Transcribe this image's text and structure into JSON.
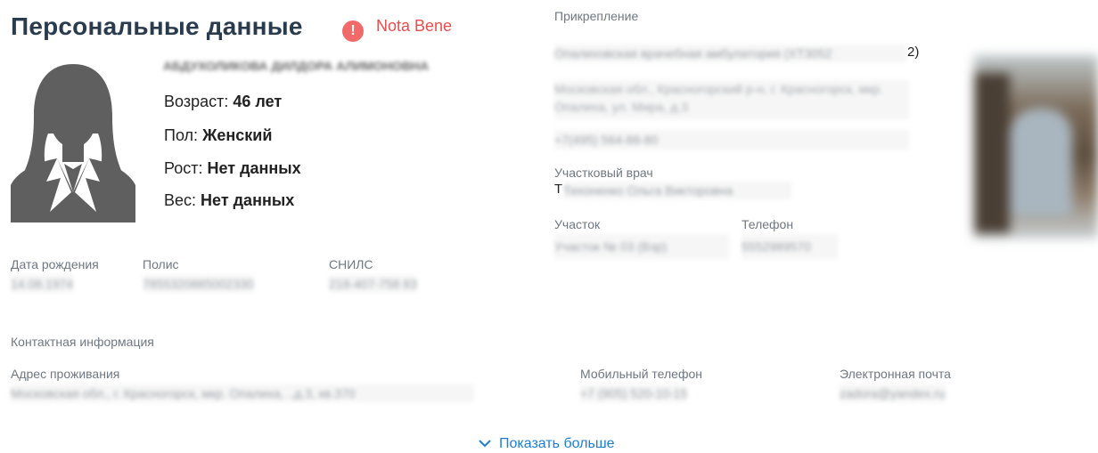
{
  "header": {
    "title": "Персональные данные",
    "nota_bene_icon": "!",
    "nota_bene": "Nota Bene"
  },
  "patient": {
    "name": "АБДУХОЛИКОВА ДИЛДОРА АЛИМОНОВНА",
    "age_label": "Возраст:",
    "age_value": "46 лет",
    "sex_label": "Пол:",
    "sex_value": "Женский",
    "height_label": "Рост:",
    "height_value": "Нет данных",
    "weight_label": "Вес:",
    "weight_value": "Нет данных"
  },
  "documents": {
    "birth_label": "Дата рождения",
    "birth_value": "14.08.1974",
    "policy_label": "Полис",
    "policy_value": "7855320885002330",
    "snils_label": "СНИЛС",
    "snils_value": "218-407-758 83"
  },
  "contacts": {
    "section_label": "Контактная информация",
    "address_label": "Адрес проживания",
    "address_value": "Московская обл., г. Красногорск, мкр. Опалиха, ..д.3, кв.370",
    "mobile_label": "Мобильный телефон",
    "mobile_value": "+7 (905) 520-10-15",
    "email_label": "Электронная почта",
    "email_value": "zadora@yandex.ru"
  },
  "attachment": {
    "label": "Прикрепление",
    "org_value": "Опалиховская врачебная амбулатория (ХТ3052",
    "org_suffix": "2)",
    "org_address": "Московская обл., Красногорский р-н, г. Красногорск, мкр. Опалиха, ул. Мира, д.3",
    "org_phone": "+7(495) 564-88-80",
    "doctor_label": "Участковый врач",
    "doctor_initial": "Т",
    "doctor_value": "Тихоненко Ольга Викторовна",
    "district_label": "Участок",
    "district_value": "Участок № 03 (Взр)",
    "phone_label": "Телефон",
    "phone_value": "5552989570"
  },
  "footer": {
    "show_more": "Показать больше",
    "show_more_icon": "chevron-down-icon"
  },
  "colors": {
    "title": "#2b3b4e",
    "nota_bene": "#e84d4d",
    "link": "#1c7ed6",
    "label": "#6f7782"
  }
}
